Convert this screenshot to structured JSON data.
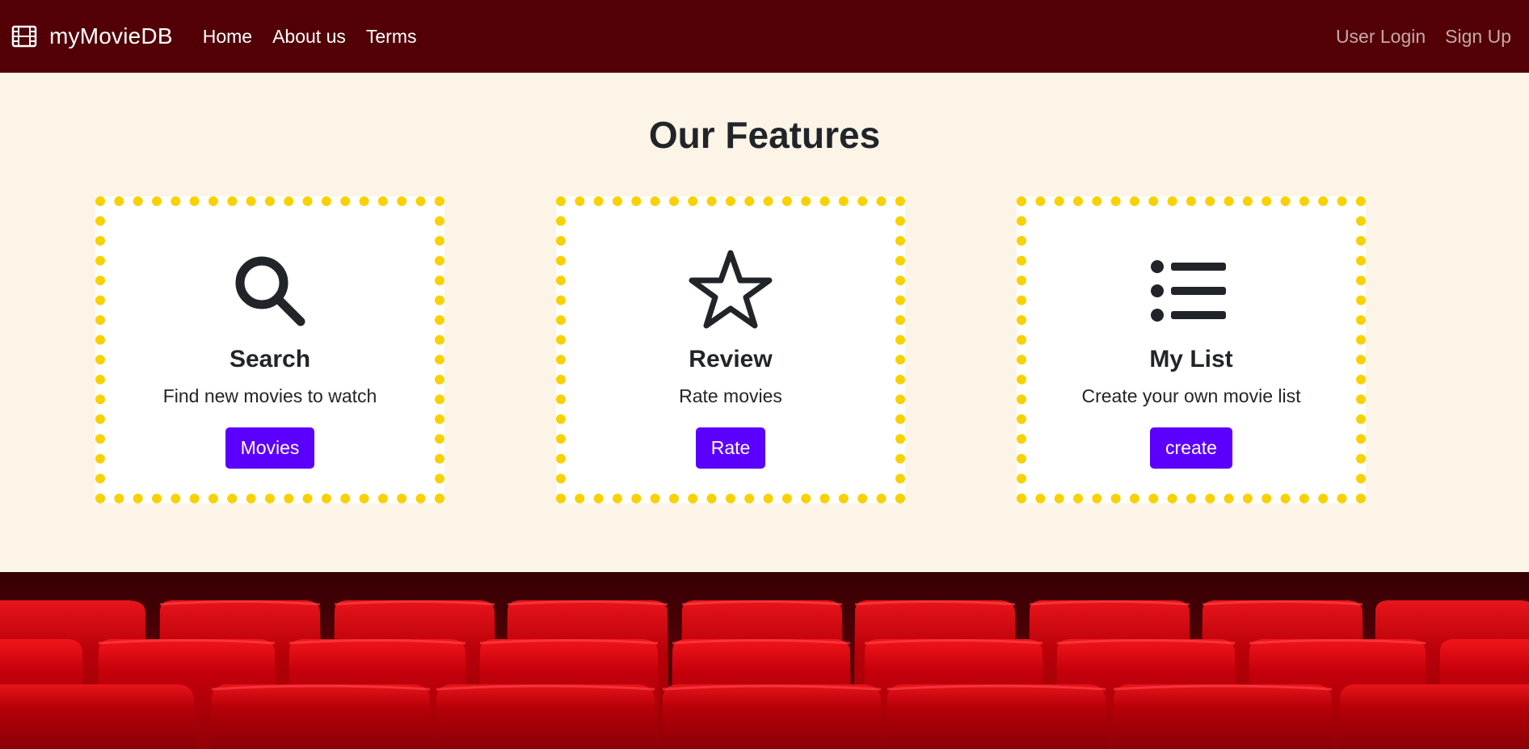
{
  "navbar": {
    "brand_name": "myMovieDB",
    "brand_icon": "film-icon",
    "links": [
      {
        "label": "Home"
      },
      {
        "label": "About us"
      },
      {
        "label": "Terms"
      }
    ],
    "user_login_label": "User Login",
    "sign_up_label": "Sign Up"
  },
  "features": {
    "title": "Our Features",
    "cards": [
      {
        "icon": "search-icon",
        "title": "Search",
        "text": "Find new movies to watch",
        "button_label": "Movies"
      },
      {
        "icon": "star-icon",
        "title": "Review",
        "text": "Rate movies",
        "button_label": "Rate"
      },
      {
        "icon": "list-icon",
        "title": "My List",
        "text": "Create your own movie list",
        "button_label": "create"
      }
    ]
  },
  "theater": {
    "image": "cinema-seats-image"
  },
  "colors": {
    "navbar_bg": "#520006",
    "page_bg": "#fcf4e6",
    "card_border": "#f8d200",
    "button_bg": "#5b00ff",
    "seat_red": "#c40000"
  }
}
